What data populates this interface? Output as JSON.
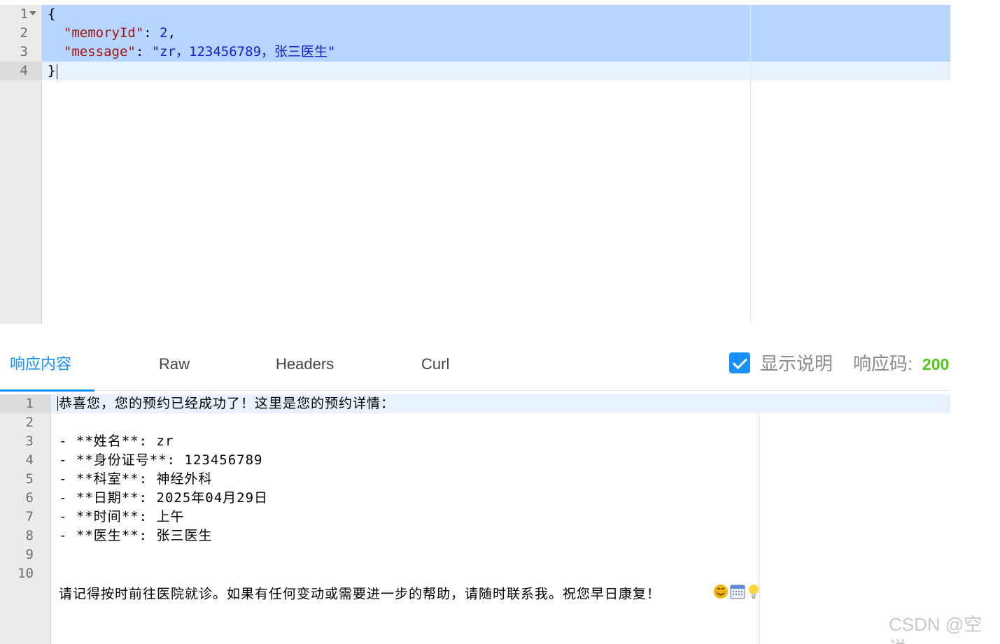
{
  "request_editor": {
    "line_numbers": [
      "1",
      "2",
      "3",
      "4"
    ],
    "lines": {
      "open": "{",
      "memory_key": "\"memoryId\"",
      "memory_colon": ": ",
      "memory_value": "2",
      "memory_comma": ",",
      "message_key": "\"message\"",
      "message_colon": ": ",
      "message_value": "\"zr，123456789，张三医生\"",
      "close": "}"
    }
  },
  "tabs": [
    {
      "label": "响应内容",
      "active": true
    },
    {
      "label": "Raw",
      "active": false
    },
    {
      "label": "Headers",
      "active": false
    },
    {
      "label": "Curl",
      "active": false
    }
  ],
  "options": {
    "show_description_label": "显示说明",
    "show_description_checked": true,
    "response_code_label": "响应码:",
    "response_code": "200"
  },
  "response_editor": {
    "line_numbers": [
      "1",
      "2",
      "3",
      "4",
      "5",
      "6",
      "7",
      "8",
      "9",
      "10"
    ],
    "lines": [
      "恭喜您，您的预约已经成功了！这里是您的预约详情：",
      "",
      "- **姓名**: zr",
      "- **身份证号**: 123456789",
      "- **科室**: 神经外科",
      "- **日期**: 2025年04月29日",
      "- **时间**: 上午",
      "- **医生**: 张三医生",
      "",
      "请记得按时前往医院就诊。如果有任何变动或需要进一步的帮助，请随时联系我。祝您早日康复！"
    ],
    "trailing_icons": [
      "smiling-face-icon",
      "calendar-icon",
      "light-bulb-icon"
    ]
  },
  "colors": {
    "accent": "#1890ff",
    "status_ok": "#52c41a",
    "selection": "#b5d5ff",
    "json_key": "#a31515",
    "json_value": "#1a1acd"
  },
  "watermark": "CSDN @空说"
}
